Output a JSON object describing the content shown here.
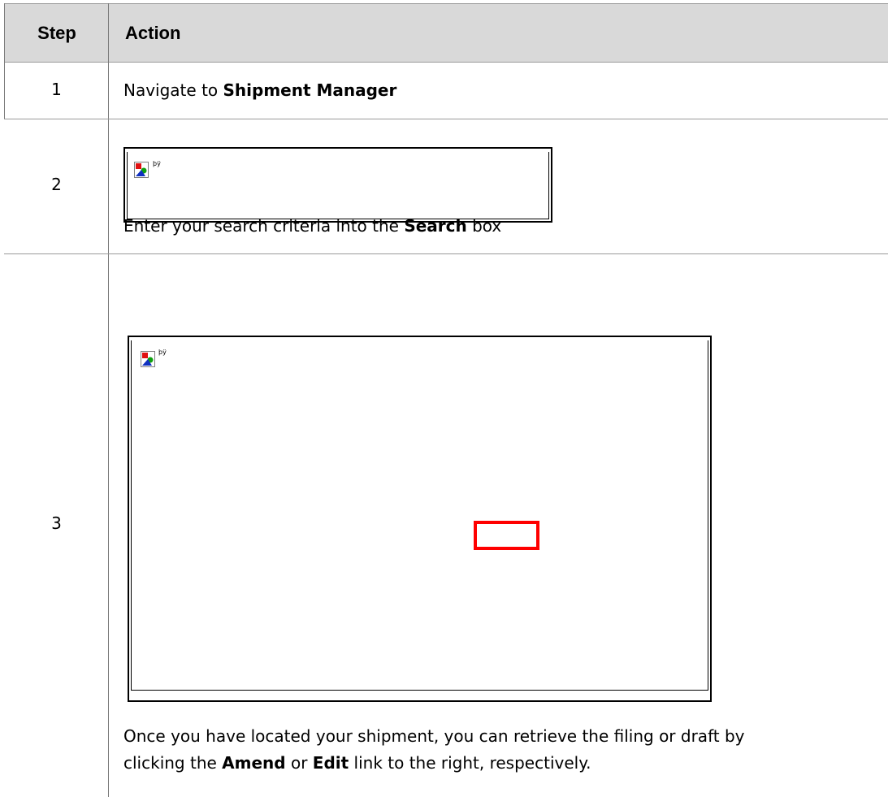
{
  "header": {
    "step": "Step",
    "action": "Action"
  },
  "rows": [
    {
      "step": "1",
      "text_before": "Navigate to ",
      "bold": "Shipment Manager",
      "text_after": ""
    },
    {
      "step": "2",
      "image_placeholder": "þÿ",
      "text_before": "Enter your search criteria into the ",
      "bold": "Search",
      "text_after": " box"
    },
    {
      "step": "3",
      "image_placeholder": "þÿ",
      "line1_before": "Once you have located your shipment, you can retrieve the filing or draft by",
      "line2_before": "clicking the ",
      "bold1": "Amend",
      "mid": " or ",
      "bold2": "Edit",
      "line2_after": " link to the right, respectively."
    }
  ],
  "colors": {
    "header_bg": "#d9d9d9",
    "highlight": "#ff0000"
  }
}
